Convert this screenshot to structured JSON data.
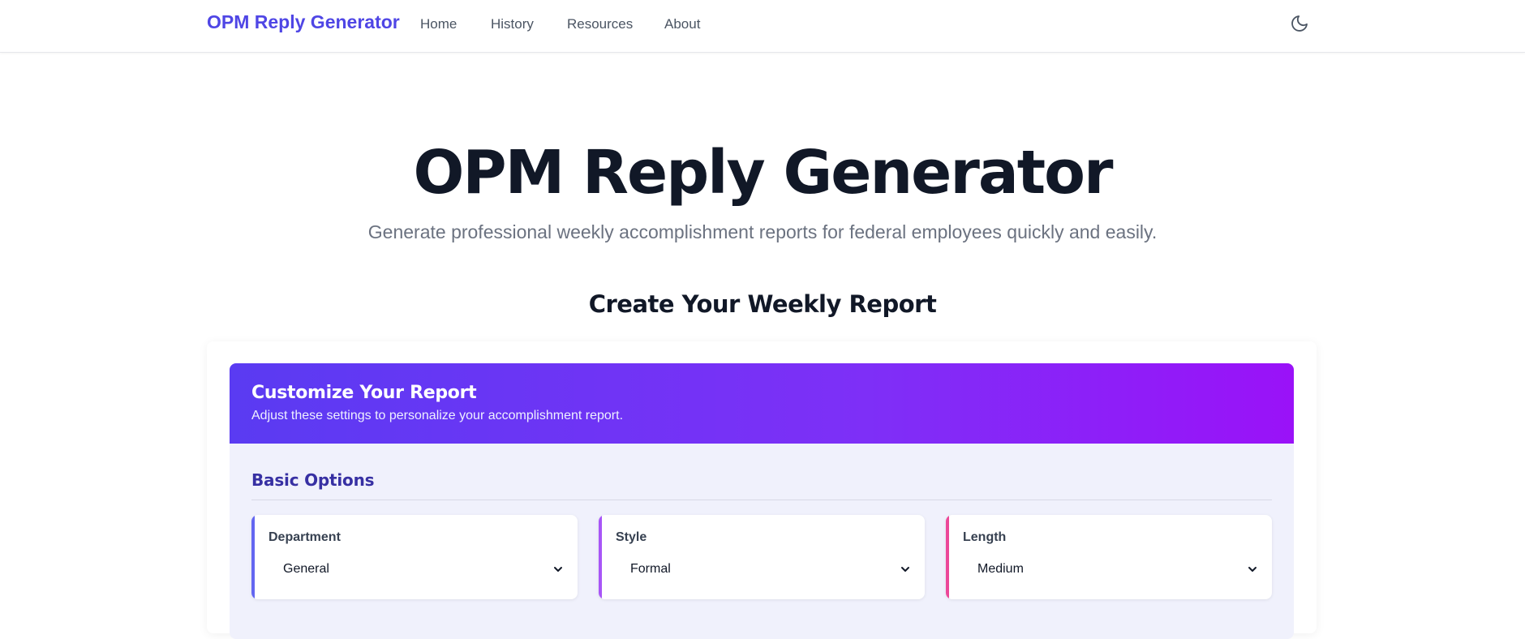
{
  "nav": {
    "brand": "OPM Reply Generator",
    "links": [
      "Home",
      "History",
      "Resources",
      "About"
    ],
    "theme_icon": "moon-icon"
  },
  "hero": {
    "title": "OPM Reply Generator",
    "subtitle": "Generate professional weekly accomplishment reports for federal employees quickly and easily."
  },
  "section": {
    "title": "Create Your Weekly Report"
  },
  "panel": {
    "title": "Customize Your Report",
    "description": "Adjust these settings to personalize your accomplishment report.",
    "group_title": "Basic Options",
    "options": [
      {
        "label": "Department",
        "value": "General",
        "accent": "#6366f1"
      },
      {
        "label": "Style",
        "value": "Formal",
        "accent": "#a855f7"
      },
      {
        "label": "Length",
        "value": "Medium",
        "accent": "#ec4899"
      }
    ]
  },
  "colors": {
    "brand": "#4f46e5",
    "header_gradient_start": "#5a3bf2",
    "header_gradient_end": "#9a12f8"
  }
}
